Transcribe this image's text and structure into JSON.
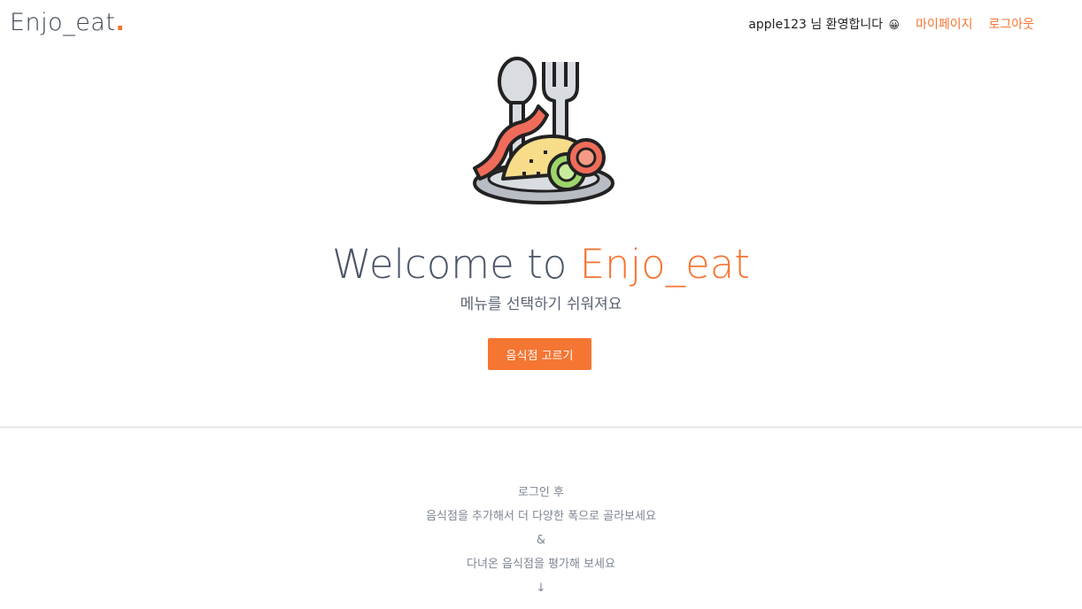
{
  "header": {
    "logo_text": "Enjo_eat",
    "logo_dot": ".",
    "greeting": "apple123 님 환영합니다",
    "greeting_emoji": "😀",
    "mypage_label": "마이페이지",
    "logout_label": "로그아웃"
  },
  "hero": {
    "title_prefix": "Welcome to ",
    "title_brand": "Enjo_eat",
    "subtitle": "메뉴를 선택하기 쉬워져요",
    "cta_label": "음식점 고르기",
    "icon": "food-plate-icon"
  },
  "info": {
    "lines": [
      "로그인 후",
      "음식점을 추가해서 더 다양한 폭으로 골라보세요",
      "&",
      "다녀온 음식점을 평가해 보세요",
      "↓"
    ]
  },
  "colors": {
    "accent": "#f57532",
    "text_dark": "#4a5568",
    "text_muted": "#7d8693"
  }
}
